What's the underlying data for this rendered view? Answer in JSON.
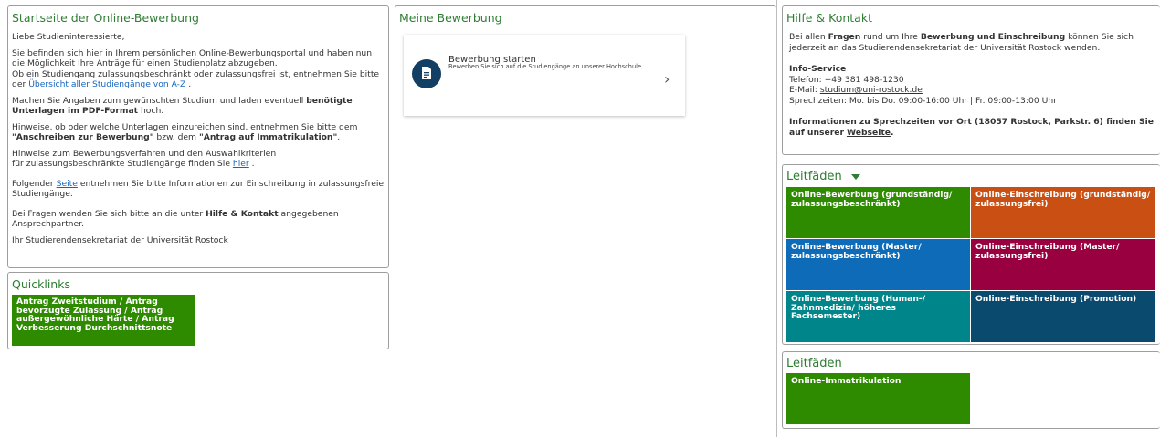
{
  "start": {
    "title": "Startseite der Online-Bewerbung",
    "greeting": "Liebe Studieninteressierte,",
    "p1_a": "Sie befinden sich hier in Ihrem persönlichen Online-Bewerbungsportal und haben nun die Möglichkeit Ihre Anträge für einen Studienplatz abzugeben.",
    "p1_b": "Ob ein Studiengang zulassungsbeschränkt oder zulassungsfrei ist, entnehmen Sie bitte der",
    "p1_link": "Übersicht aller Studiengänge von A-Z",
    "p1_end": ".",
    "p2_a": "Machen Sie Angaben zum gewünschten Studium und laden eventuell",
    "p2_bold": "benötigte Unterlagen im PDF-Format",
    "p2_end": "hoch.",
    "p3_a": "Hinweise, ob oder welche Unterlagen einzureichen sind, entnehmen Sie bitte dem",
    "p3_bold1": "\"Anschreiben zur Bewerbung\"",
    "p3_mid": "bzw. dem",
    "p3_bold2": "\"Antrag auf Immatrikulation\"",
    "p3_end": ".",
    "p4_a": "Hinweise zum Bewerbungsverfahren und den Auswahlkriterien",
    "p4_b": "für zulassungsbeschränkte Studiengänge finden Sie",
    "p4_link": "hier",
    "p4_end": ".",
    "p5_a": "Folgender",
    "p5_link": "Seite",
    "p5_b": "entnehmen Sie bitte Informationen zur Einschreibung in zulassungsfreie Studiengänge.",
    "p6_a": "Bei Fragen wenden Sie sich bitte an die unter",
    "p6_bold": "Hilfe & Kontakt",
    "p6_b": "angegebenen Ansprechpartner.",
    "p7": "Ihr Studierendensekretariat der Universität Rostock"
  },
  "quicklinks": {
    "title": "Quicklinks",
    "tile_label": "Antrag Zweitstudium / Antrag bevorzugte Zulassung / Antrag außergewöhnliche Härte / Antrag Verbesserung Durchschnittsnote",
    "tile_color": "#2e8b00"
  },
  "meine": {
    "title": "Meine Bewerbung",
    "card_title": "Bewerbung starten",
    "card_subtitle": "Bewerben Sie sich auf die Studiengänge an unserer Hochschule.",
    "icon": "document-icon",
    "chevron": "›"
  },
  "hilfe": {
    "title": "Hilfe & Kontakt",
    "intro_a": "Bei allen",
    "intro_bold1": "Fragen",
    "intro_b": "rund um Ihre",
    "intro_bold2": "Bewerbung und Einschreibung",
    "intro_c": "können Sie sich jederzeit an das Studierendensekretariat der Universität Rostock wenden.",
    "info_title": "Info-Service",
    "phone": "Telefon: +49 381 498-1230",
    "email_label": "E-Mail:",
    "email": "studium@uni-rostock.de",
    "hours": "Sprechzeiten: Mo. bis Do. 09:00-16:00 Uhr | Fr. 09:00-13:00 Uhr",
    "onsite_a": "Informationen zu Sprechzeiten vor Ort (18057 Rostock, Parkstr. 6) finden Sie auf unserer",
    "onsite_link": "Webseite",
    "onsite_end": "."
  },
  "leitfaeden1": {
    "title": "Leitfäden",
    "toggle_icon": "caret-down-icon",
    "tiles": [
      {
        "label": "Online-Bewerbung (grundständig/ zulassungsbeschränkt)",
        "color": "#2e8b00"
      },
      {
        "label": "Online-Einschreibung (grundständig/ zulassungsfrei)",
        "color": "#c94f12"
      },
      {
        "label": "Online-Bewerbung (Master/ zulassungsbeschränkt)",
        "color": "#0d6bb8"
      },
      {
        "label": "Online-Einschreibung (Master/ zulassungsfrei)",
        "color": "#99003f"
      },
      {
        "label": "Online-Bewerbung (Human-/ Zahnmedizin/ höheres Fachsemester)",
        "color": "#00868a"
      },
      {
        "label": "Online-Einschreibung (Promotion)",
        "color": "#0a4a6e"
      }
    ]
  },
  "leitfaeden2": {
    "title": "Leitfäden",
    "tiles": [
      {
        "label": "Online-Immatrikulation",
        "color": "#2e8b00"
      }
    ]
  }
}
